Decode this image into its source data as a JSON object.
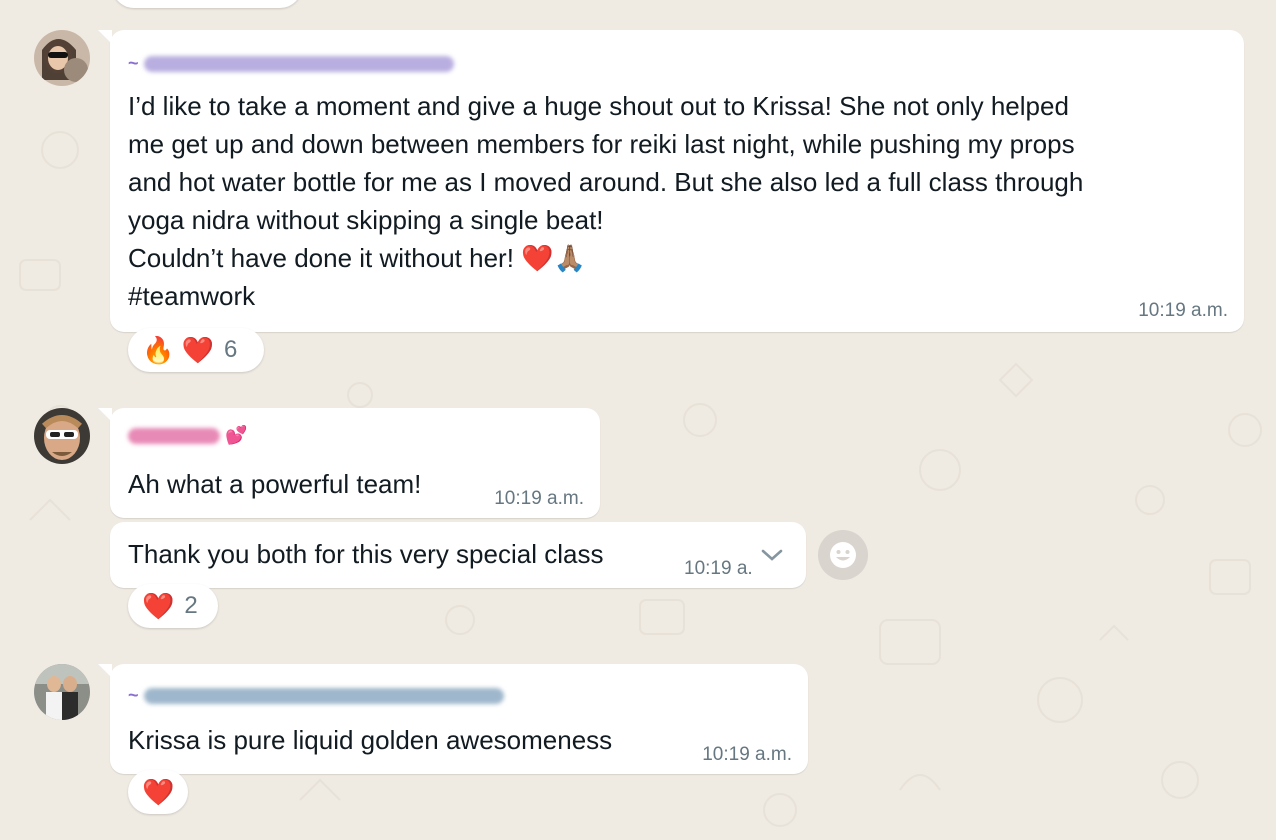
{
  "colors": {
    "background": "#efeae2",
    "bubble": "#ffffff",
    "timestamp": "#667781",
    "sender_tilde": "#8a6fd1",
    "blur_pink": "#e88ab6"
  },
  "messages": [
    {
      "sender_prefix": "~",
      "text": "I’d like to take a moment and give a huge shout out to Krissa! She not only helped\nme get up and down between members for reiki last night, while pushing my props\nand hot water bottle for me as I moved around. But she also led a full class through\nyoga nidra without skipping a single beat!\nCouldn’t have done it without her! ❤️🙏🏽\n#teamwork",
      "time": "10:19 a.m.",
      "reactions": {
        "emojis": "🔥 ❤️",
        "count": "6"
      }
    },
    {
      "sender_prefix": "",
      "text": "Ah what a powerful team!",
      "time": "10:19 a.m."
    },
    {
      "text": "Thank you both for this very special class",
      "time": "10:19 a.",
      "reactions": {
        "emojis": "❤️",
        "count": "2"
      }
    },
    {
      "sender_prefix": "~",
      "text": "Krissa is pure liquid golden awesomeness",
      "time": "10:19 a.m.",
      "reactions": {
        "emojis": "❤️",
        "count": ""
      }
    }
  ],
  "icons": {
    "emoji_button": "smiley-face-icon",
    "menu_chevron": "chevron-down-icon"
  }
}
